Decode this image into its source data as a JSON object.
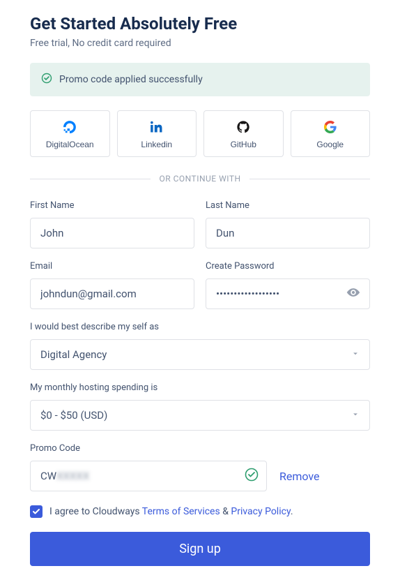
{
  "title": "Get Started Absolutely Free",
  "subtitle": "Free trial, No credit card required",
  "promo_banner": "Promo code applied successfully",
  "social": {
    "digitalocean": "DigitalOcean",
    "linkedin": "Linkedin",
    "github": "GitHub",
    "google": "Google"
  },
  "divider": "OR CONTINUE WITH",
  "labels": {
    "first_name": "First Name",
    "last_name": "Last Name",
    "email": "Email",
    "password": "Create Password",
    "describe": "I would best describe my self as",
    "spending": "My monthly hosting spending is",
    "promo": "Promo Code"
  },
  "values": {
    "first_name": "John",
    "last_name": "Dun",
    "email": "johndun@gmail.com",
    "password": "••••••••••••••••••",
    "describe": "Digital Agency",
    "spending": "$0 - $50 (USD)",
    "promo_prefix": "CW",
    "promo_hidden": "XXXXX"
  },
  "remove": "Remove",
  "agree": {
    "prefix": "I agree to Cloudways ",
    "terms": "Terms of Services",
    "amp": " & ",
    "privacy": "Privacy Policy",
    "suffix": "."
  },
  "signup": "Sign up"
}
